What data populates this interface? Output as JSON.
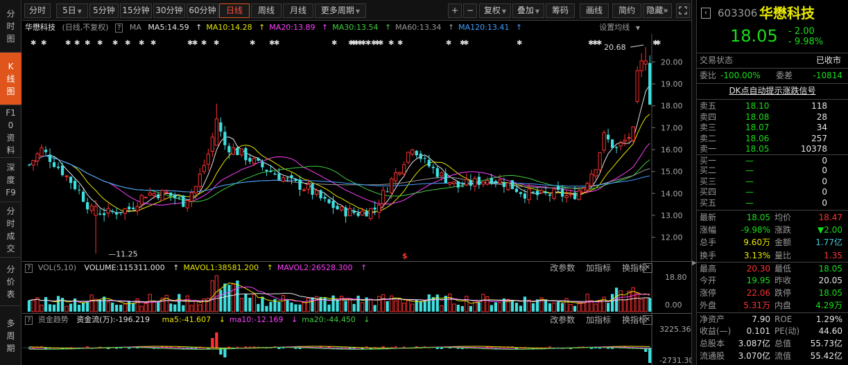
{
  "leftnav": [
    {
      "label": "分时图",
      "active": false
    },
    {
      "label": "K线图",
      "active": true
    },
    {
      "label": "F10资料",
      "active": false
    },
    {
      "label": "深度F9",
      "active": false
    },
    {
      "label": "分时成交",
      "active": false
    },
    {
      "label": "分价表",
      "active": false
    },
    {
      "label": "多周期",
      "active": false
    }
  ],
  "toolbar": {
    "periods": [
      {
        "label": "分时",
        "active": false,
        "dropdown": false
      },
      {
        "label": "5日",
        "active": false,
        "dropdown": true
      },
      {
        "label": "5分钟",
        "active": false,
        "dropdown": false
      },
      {
        "label": "15分钟",
        "active": false,
        "dropdown": false
      },
      {
        "label": "30分钟",
        "active": false,
        "dropdown": false
      },
      {
        "label": "60分钟",
        "active": false,
        "dropdown": false
      },
      {
        "label": "日线",
        "active": true,
        "dropdown": false
      },
      {
        "label": "周线",
        "active": false,
        "dropdown": false
      },
      {
        "label": "月线",
        "active": false,
        "dropdown": false
      },
      {
        "label": "更多周期",
        "active": false,
        "dropdown": true
      }
    ],
    "zoom_in": "+",
    "zoom_out": "−",
    "tools": [
      {
        "label": "复权",
        "dropdown": true
      },
      {
        "label": "叠加",
        "dropdown": true
      },
      {
        "label": "筹码",
        "dropdown": false
      },
      {
        "label": "画线",
        "dropdown": false
      },
      {
        "label": "简约",
        "dropdown": false
      },
      {
        "label": "隐藏",
        "dropdown": false
      }
    ],
    "more": "»",
    "fullscreen_icon": "fullscreen-icon"
  },
  "main": {
    "name": "华懋科技",
    "mode": "(日线,不复权)",
    "ma_tag": "MA",
    "ma": [
      {
        "label": "MA5:14.59",
        "color": "#e8e8e8"
      },
      {
        "label": "MA10:14.28",
        "color": "#e8e800"
      },
      {
        "label": "MA20:13.89",
        "color": "#ff40ff"
      },
      {
        "label": "MA30:13.54",
        "color": "#40d040"
      },
      {
        "label": "MA60:13.34",
        "color": "#9a9a9a"
      },
      {
        "label": "MA120:13.41",
        "color": "#40a0ff"
      }
    ],
    "settings": "设置均线",
    "max_label": "20.68",
    "min_label": "11.25",
    "marker": "$"
  },
  "volume": {
    "title": "VOL(5,10)",
    "items": [
      {
        "label": "VOLUME:115311.000",
        "color": "#e8e8e8"
      },
      {
        "label": "MAVOL1:38581.200",
        "color": "#e8e800"
      },
      {
        "label": "MAVOL2:26528.300",
        "color": "#ff40ff"
      }
    ],
    "axis": [
      "18.80",
      "0.00"
    ],
    "buttons": [
      "改参数",
      "加指标",
      "换指标"
    ]
  },
  "flow": {
    "title": "资金趋势",
    "items": [
      {
        "label": "资金流(万):-196.219",
        "color": "#e8e8e8"
      },
      {
        "label": "ma5:-41.607",
        "color": "#e8e800"
      },
      {
        "label": "ma10:-12.169",
        "color": "#ff40ff"
      },
      {
        "label": "ma20:-44.450",
        "color": "#40d040"
      }
    ],
    "axis": [
      "3225.36",
      "-2731.30"
    ],
    "buttons": [
      "改参数",
      "加指标",
      "换指标"
    ]
  },
  "chart_data": {
    "type": "candlestick",
    "y_axis_ticks": [
      "20.00",
      "19.00",
      "18.00",
      "17.00",
      "16.00",
      "15.00",
      "14.00",
      "13.00",
      "12.00"
    ],
    "ylim": [
      11.25,
      20.68
    ],
    "high": 20.68,
    "low": 11.25,
    "last_close": 18.05,
    "candles": 150,
    "up_color": "#ff3232",
    "down_color": "#40e0e0"
  },
  "quote": {
    "code": "603306",
    "name": "华懋科技",
    "price": "18.05",
    "change": "- 2.00",
    "pct": "- 9.98%",
    "status_label": "交易状态",
    "status_value": "已收市",
    "weibi_label": "委比",
    "weibi_value": "-100.00%",
    "weicha_label": "委差",
    "weicha_value": "-10814",
    "dk_link": "DK点自动提示涨跌信号",
    "sell": [
      {
        "label": "卖五",
        "price": "18.10",
        "vol": "118"
      },
      {
        "label": "卖四",
        "price": "18.08",
        "vol": "28"
      },
      {
        "label": "卖三",
        "price": "18.07",
        "vol": "34"
      },
      {
        "label": "卖二",
        "price": "18.06",
        "vol": "257"
      },
      {
        "label": "卖一",
        "price": "18.05",
        "vol": "10378"
      }
    ],
    "buy": [
      {
        "label": "买一",
        "price": "—",
        "vol": "0"
      },
      {
        "label": "买二",
        "price": "—",
        "vol": "0"
      },
      {
        "label": "买三",
        "price": "—",
        "vol": "0"
      },
      {
        "label": "买四",
        "price": "—",
        "vol": "0"
      },
      {
        "label": "买五",
        "price": "—",
        "vol": "0"
      }
    ],
    "stats": [
      {
        "l1": "最新",
        "v1": "18.05",
        "c1": "g",
        "l2": "均价",
        "v2": "18.47",
        "c2": "r"
      },
      {
        "l1": "涨幅",
        "v1": "-9.98%",
        "c1": "g",
        "l2": "涨跌",
        "v2": "▼2.00",
        "c2": "g"
      },
      {
        "l1": "总手",
        "v1": "9.60万",
        "c1": "y",
        "l2": "金额",
        "v2": "1.77亿",
        "c2": "c"
      },
      {
        "l1": "换手",
        "v1": "3.13%",
        "c1": "y",
        "l2": "量比",
        "v2": "1.35",
        "c2": "r"
      },
      {
        "l1": "最高",
        "v1": "20.30",
        "c1": "r",
        "l2": "最低",
        "v2": "18.05",
        "c2": "g"
      },
      {
        "l1": "今开",
        "v1": "19.95",
        "c1": "g",
        "l2": "昨收",
        "v2": "20.05",
        "c2": "w"
      },
      {
        "l1": "涨停",
        "v1": "22.06",
        "c1": "r",
        "l2": "跌停",
        "v2": "18.05",
        "c2": "g"
      },
      {
        "l1": "外盘",
        "v1": "5.31万",
        "c1": "r",
        "l2": "内盘",
        "v2": "4.29万",
        "c2": "g"
      },
      {
        "l1": "净资产",
        "v1": "7.90",
        "c1": "w",
        "l2": "ROE",
        "v2": "1.29%",
        "c2": "w"
      },
      {
        "l1": "收益(—)",
        "v1": "0.101",
        "c1": "w",
        "l2": "PE(动)",
        "v2": "44.60",
        "c2": "w"
      },
      {
        "l1": "总股本",
        "v1": "3.087亿",
        "c1": "w",
        "l2": "总值",
        "v2": "55.73亿",
        "c2": "w"
      },
      {
        "l1": "流通股",
        "v1": "3.070亿",
        "c1": "w",
        "l2": "流值",
        "v2": "55.42亿",
        "c2": "w"
      }
    ]
  },
  "colors": {
    "accent": "#e0551c",
    "up": "#ff3232",
    "down": "#18e018",
    "cyan": "#40e0e0",
    "yellow": "#e8e800"
  }
}
